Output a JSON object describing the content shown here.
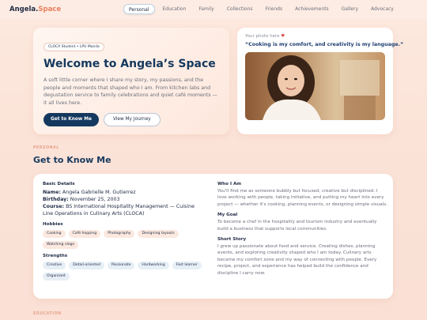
{
  "brand": {
    "name_main": "Angela.",
    "name_accent": "Space"
  },
  "nav": {
    "items": [
      {
        "label": "Personal",
        "active": true
      },
      {
        "label": "Education"
      },
      {
        "label": "Family"
      },
      {
        "label": "Collections"
      },
      {
        "label": "Friends"
      },
      {
        "label": "Achievements"
      },
      {
        "label": "Gallery"
      },
      {
        "label": "Advocacy"
      }
    ]
  },
  "hero": {
    "chip": "CLOCA Student • LPU Manila",
    "title": "Welcome to Angela’s Space",
    "description": "A soft little corner where I share my story, my passions, and the people and moments that shaped who I am. From kitchen labs and degustation service to family celebrations and quiet café moments — it all lives here.",
    "primary_button": "Get to Know Me",
    "secondary_button": "View My Journey"
  },
  "photo_card": {
    "label": "Your photo here",
    "quote": "“Cooking is my comfort, and creativity is my language.”"
  },
  "section": {
    "kicker": "PERSONAL",
    "title": "Get to Know Me"
  },
  "about": {
    "basic_heading": "Basic Details",
    "name_label": "Name:",
    "name_value": "Angela Gabrielle M. Gutierrez",
    "birthday_label": "Birthday:",
    "birthday_value": "November 25, 2003",
    "course_label": "Course:",
    "course_value": "BS International Hospitality Management — Cuisine Line Operations in Culinary Arts (CLOCA)",
    "hobbies_heading": "Hobbies",
    "hobbies": [
      "Cooking",
      "Café hopping",
      "Photography",
      "Designing layouts",
      "Watching vlogs"
    ],
    "strengths_heading": "Strengths",
    "strengths": [
      "Creative",
      "Detail-oriented",
      "Passionate",
      "Hardworking",
      "Fast learner",
      "Organized"
    ],
    "who_heading": "Who I Am",
    "who_text": "You'll find me as someone bubbly but focused, creative but disciplined. I love working with people, taking initiative, and putting my heart into every project — whether it's cooking, planning events, or designing simple visuals.",
    "goal_heading": "My Goal",
    "goal_text": "To become a chef in the hospitality and tourism industry and eventually build a business that supports local communities.",
    "story_heading": "Short Story",
    "story_text": "I grew up passionate about food and service. Creating dishes, planning events, and exploring creativity shaped who I am today. Culinary arts became my comfort zone and my way of connecting with people. Every recipe, project, and experience has helped build the confidence and discipline I carry now."
  },
  "footer": {
    "kicker": "EDUCATION"
  }
}
